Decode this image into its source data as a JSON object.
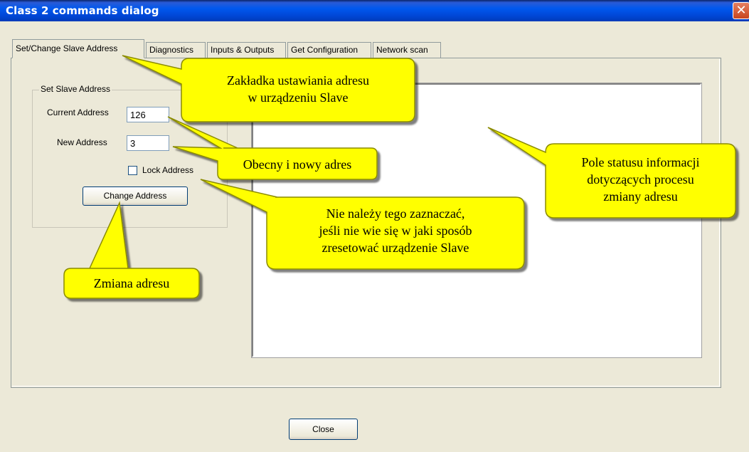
{
  "window": {
    "title": "Class 2 commands dialog"
  },
  "tabs": [
    {
      "label": "Set/Change Slave Address",
      "active": true
    },
    {
      "label": "Diagnostics",
      "active": false
    },
    {
      "label": "Inputs & Outputs",
      "active": false
    },
    {
      "label": "Get Configuration",
      "active": false
    },
    {
      "label": "Network scan",
      "active": false
    }
  ],
  "group": {
    "title": "Set Slave Address",
    "current_address_label": "Current Address",
    "current_address_value": "126",
    "new_address_label": "New Address",
    "new_address_value": "3",
    "lock_label": "Lock Address",
    "lock_checked": false,
    "change_button": "Change Address"
  },
  "close_button": "Close",
  "callouts": {
    "tab": [
      "Zakładka ustawiania adresu",
      "w urządzeniu Slave"
    ],
    "addresses": [
      "Obecny i nowy adres"
    ],
    "lock": [
      "Nie należy tego zaznaczać,",
      "jeśli nie wie się w jaki sposób",
      "zresetować urządzenie Slave"
    ],
    "change": [
      "Zmiana adresu"
    ],
    "status": [
      "Pole statusu informacji",
      "dotyczących procesu",
      "zmiany adresu"
    ]
  },
  "colors": {
    "callout_fill": "#ffff00",
    "callout_border": "#8b8b00",
    "titlebar": "#0054e3"
  }
}
